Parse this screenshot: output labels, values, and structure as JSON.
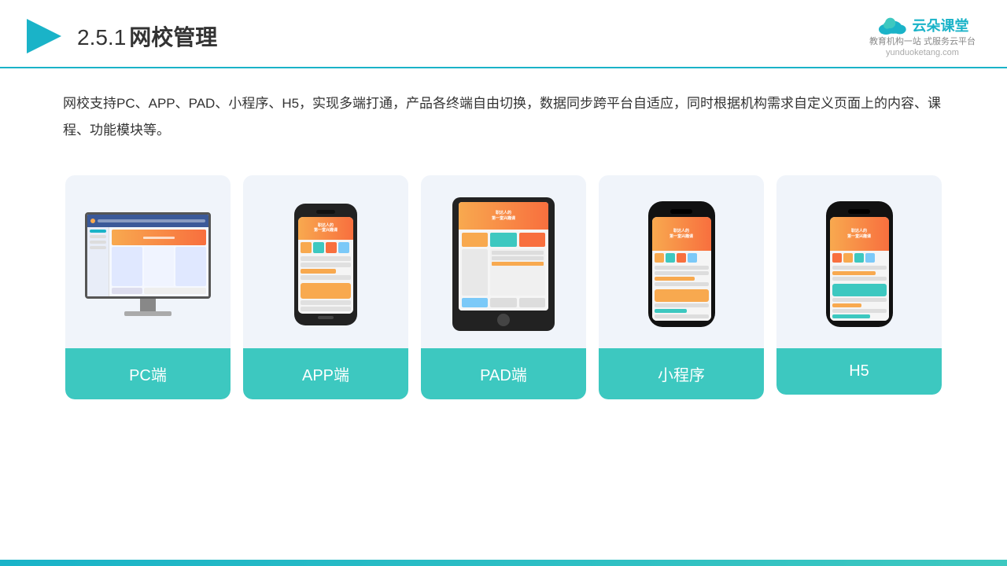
{
  "header": {
    "title": "网校管理",
    "title_number": "2.5.1",
    "logo_name": "云朵课堂",
    "logo_url": "yunduoketang.com",
    "logo_slogan": "教育机构一站\n式服务云平台"
  },
  "description": {
    "text": "网校支持PC、APP、PAD、小程序、H5，实现多端打通，产品各终端自由切换，数据同步跨平台自适应，同时根据机构需求自定义页面上的内容、课程、功能模块等。"
  },
  "cards": [
    {
      "id": "pc",
      "label": "PC端"
    },
    {
      "id": "app",
      "label": "APP端"
    },
    {
      "id": "pad",
      "label": "PAD端"
    },
    {
      "id": "miniprogram",
      "label": "小程序"
    },
    {
      "id": "h5",
      "label": "H5"
    }
  ],
  "colors": {
    "teal": "#3dc8c0",
    "teal_dark": "#1ab3c8",
    "orange": "#f8a94f",
    "bg_card": "#edf2f9"
  }
}
